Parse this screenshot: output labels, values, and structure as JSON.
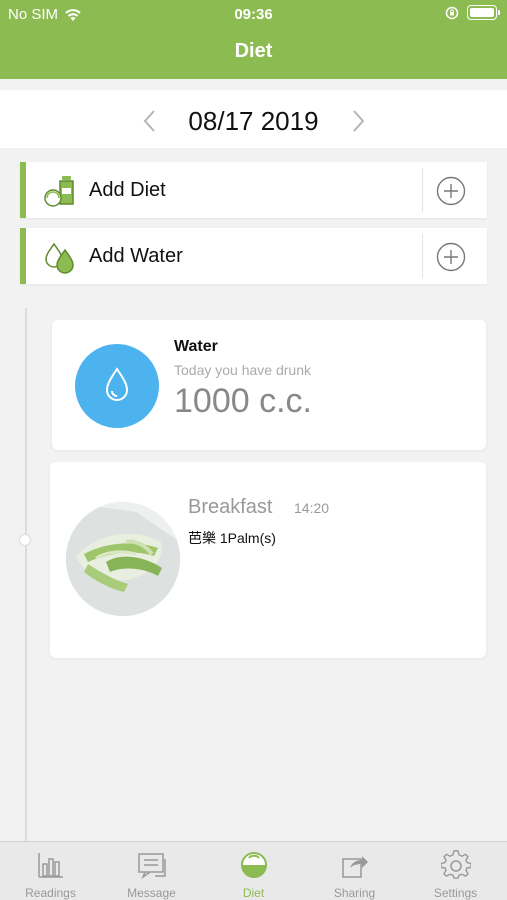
{
  "status_bar": {
    "carrier": "No SIM",
    "time": "09:36"
  },
  "header": {
    "title": "Diet"
  },
  "date_nav": {
    "date": "08/17 2019"
  },
  "add_rows": [
    {
      "label": "Add Diet",
      "icon": "food-bottle-icon"
    },
    {
      "label": "Add Water",
      "icon": "water-drops-icon"
    }
  ],
  "water_card": {
    "title": "Water",
    "subtitle": "Today you have drunk",
    "amount": "1000 c.c."
  },
  "meal_card": {
    "name": "Breakfast",
    "time": "14:20",
    "item": "芭樂 1Palm(s)"
  },
  "tabbar": {
    "tabs": [
      {
        "label": "Readings",
        "icon": "bar-chart-icon"
      },
      {
        "label": "Message",
        "icon": "message-icon"
      },
      {
        "label": "Diet",
        "icon": "diet-bowl-icon",
        "active": true
      },
      {
        "label": "Sharing",
        "icon": "share-icon"
      },
      {
        "label": "Settings",
        "icon": "gear-icon"
      }
    ]
  },
  "colors": {
    "accent": "#8cbb52",
    "water_blue": "#4db3ee",
    "muted_text": "#999999"
  }
}
